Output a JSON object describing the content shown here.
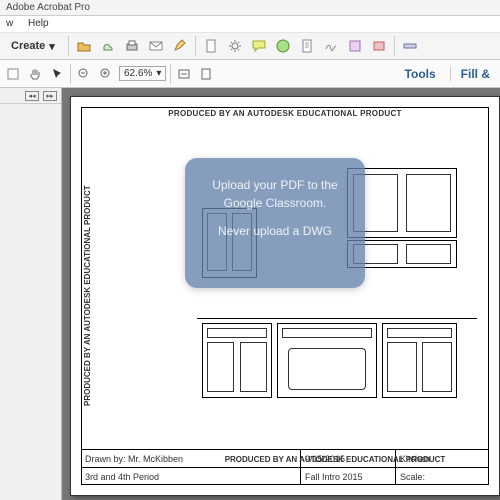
{
  "app": {
    "title": "Adobe Acrobat Pro"
  },
  "menu": {
    "items": [
      "w",
      "Help"
    ]
  },
  "toolbar": {
    "create_label": "Create"
  },
  "zoom": {
    "value": "62.6%"
  },
  "rightPane": {
    "tools": "Tools",
    "fill": "Fill &"
  },
  "watermark": "PRODUCED BY AN AUTODESK EDUCATIONAL PRODUCT",
  "titleblock": {
    "row1": {
      "drawn": "Drawn by: Mr. McKibben",
      "date": "9/15/2015",
      "proj": "Kitchen"
    },
    "row2": {
      "period": "3rd and 4th Period",
      "course": "Fall Intro 2015",
      "scale": "Scale:"
    }
  },
  "overlay": {
    "line1": "Upload your PDF to the",
    "line2": "Google Classroom.",
    "line3": "Never upload a DWG"
  },
  "icons": {
    "dropdown": "▾",
    "left": "◂◂",
    "right": "▸▸"
  }
}
